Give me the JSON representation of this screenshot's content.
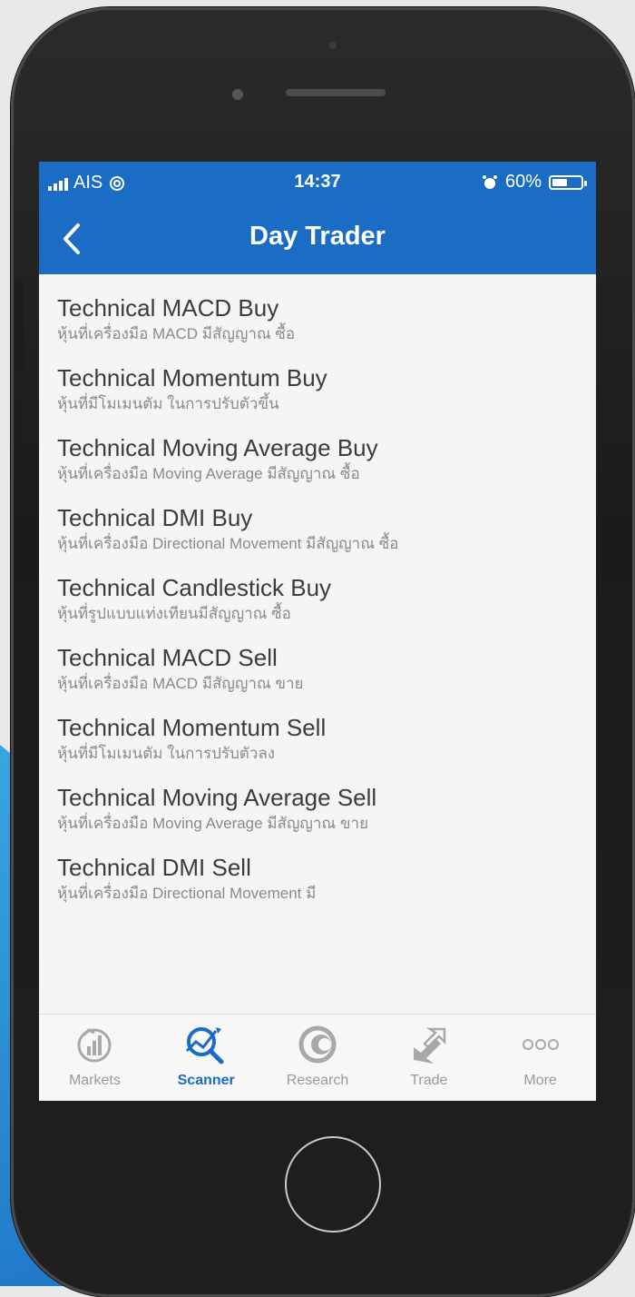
{
  "status_bar": {
    "carrier": "AIS",
    "time": "14:37",
    "battery": "60%",
    "battery_level": 0.6
  },
  "header": {
    "title": "Day Trader",
    "back_icon": "chevron-left-icon"
  },
  "scanner_list": [
    {
      "title": "Technical MACD Buy",
      "subtitle": "หุ้นที่เครื่องมือ MACD มีสัญญาณ ซื้อ"
    },
    {
      "title": "Technical Momentum Buy",
      "subtitle": "หุ้นที่มีโมเมนตัม ในการปรับตัวขึ้น"
    },
    {
      "title": "Technical Moving Average Buy",
      "subtitle": "หุ้นที่เครื่องมือ Moving Average มีสัญญาณ ซื้อ"
    },
    {
      "title": "Technical DMI Buy",
      "subtitle": "หุ้นที่เครื่องมือ Directional Movement มีสัญญาณ ซื้อ"
    },
    {
      "title": "Technical Candlestick Buy",
      "subtitle": "หุ้นที่รูปแบบแท่งเทียนมีสัญญาณ ซื้อ"
    },
    {
      "title": "Technical MACD Sell",
      "subtitle": "หุ้นที่เครื่องมือ MACD มีสัญญาณ ขาย"
    },
    {
      "title": "Technical Momentum Sell",
      "subtitle": "หุ้นที่มีโมเมนตัม ในการปรับตัวลง"
    },
    {
      "title": "Technical Moving Average Sell",
      "subtitle": "หุ้นที่เครื่องมือ Moving Average มีสัญญาณ ขาย"
    },
    {
      "title": "Technical DMI Sell",
      "subtitle": "หุ้นที่เครื่องมือ Directional Movement มี"
    }
  ],
  "tab_bar": {
    "tabs": [
      {
        "label": "Markets",
        "icon": "markets-chart-icon",
        "active": false
      },
      {
        "label": "Scanner",
        "icon": "scanner-magnifier-icon",
        "active": true
      },
      {
        "label": "Research",
        "icon": "research-circle-icon",
        "active": false
      },
      {
        "label": "Trade",
        "icon": "trade-arrows-icon",
        "active": false
      },
      {
        "label": "More",
        "icon": "more-dots-icon",
        "active": false
      }
    ]
  },
  "colors": {
    "brand_blue": "#1b6cc4",
    "active_tab": "#1b6cc4",
    "inactive_tab": "#9a9a9a"
  }
}
